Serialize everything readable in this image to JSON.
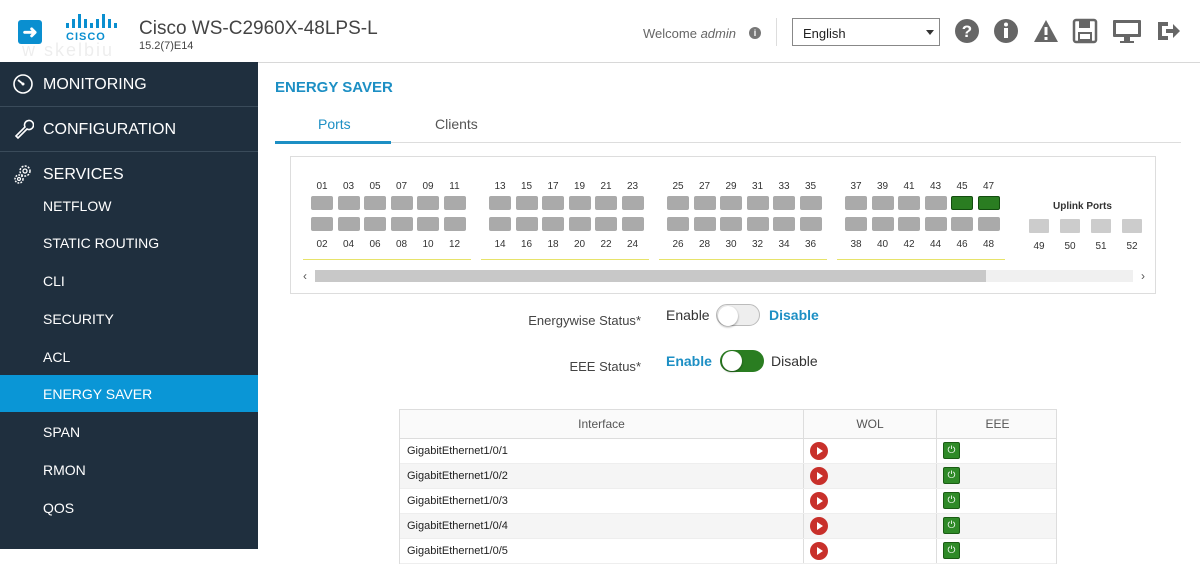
{
  "header": {
    "logo_text": "CISCO",
    "device_name": "Cisco WS-C2960X-48LPS-L",
    "version": "15.2(7)E14",
    "welcome_prefix": "Welcome ",
    "welcome_user": "admin",
    "language": "English"
  },
  "sidebar": {
    "monitoring": "MONITORING",
    "configuration": "CONFIGURATION",
    "services": "SERVICES",
    "items": [
      {
        "label": "NETFLOW"
      },
      {
        "label": "STATIC ROUTING"
      },
      {
        "label": "CLI"
      },
      {
        "label": "SECURITY"
      },
      {
        "label": "ACL"
      },
      {
        "label": "ENERGY SAVER",
        "active": true
      },
      {
        "label": "SPAN"
      },
      {
        "label": "RMON"
      },
      {
        "label": "QOS"
      }
    ]
  },
  "main": {
    "title": "ENERGY SAVER",
    "tabs": [
      {
        "label": "Ports",
        "active": true
      },
      {
        "label": "Clients"
      }
    ],
    "ports": {
      "groups": [
        {
          "top": [
            "01",
            "03",
            "05",
            "07",
            "09",
            "11"
          ],
          "bottom": [
            "02",
            "04",
            "06",
            "08",
            "10",
            "12"
          ],
          "top_on": [
            false,
            false,
            false,
            false,
            false,
            false
          ]
        },
        {
          "top": [
            "13",
            "15",
            "17",
            "19",
            "21",
            "23"
          ],
          "bottom": [
            "14",
            "16",
            "18",
            "20",
            "22",
            "24"
          ],
          "top_on": [
            false,
            false,
            false,
            false,
            false,
            false
          ]
        },
        {
          "top": [
            "25",
            "27",
            "29",
            "31",
            "33",
            "35"
          ],
          "bottom": [
            "26",
            "28",
            "30",
            "32",
            "34",
            "36"
          ],
          "top_on": [
            false,
            false,
            false,
            false,
            false,
            false
          ]
        },
        {
          "top": [
            "37",
            "39",
            "41",
            "43",
            "45",
            "47"
          ],
          "bottom": [
            "38",
            "40",
            "42",
            "44",
            "46",
            "48"
          ],
          "top_on": [
            false,
            false,
            false,
            false,
            true,
            true
          ]
        }
      ],
      "uplink_title": "Uplink Ports",
      "uplinks": [
        "49",
        "50",
        "51",
        "52"
      ]
    },
    "energywise": {
      "label": "Energywise Status",
      "required_mark": "*",
      "enable": "Enable",
      "disable": "Disable",
      "value": "Disable"
    },
    "eee": {
      "label": "EEE Status",
      "required_mark": "*",
      "enable": "Enable",
      "disable": "Disable",
      "value": "Enable"
    },
    "table": {
      "headers": [
        "Interface",
        "WOL",
        "EEE"
      ],
      "rows": [
        {
          "interface": "GigabitEthernet1/0/1"
        },
        {
          "interface": "GigabitEthernet1/0/2"
        },
        {
          "interface": "GigabitEthernet1/0/3"
        },
        {
          "interface": "GigabitEthernet1/0/4"
        },
        {
          "interface": "GigabitEthernet1/0/5"
        }
      ]
    }
  },
  "colors": {
    "accent": "#1d8fc4",
    "sidebar_bg": "#1f2f3e",
    "active_item": "#0a96d6",
    "port_on": "#2a7d21",
    "wol": "#c8302b",
    "eee": "#2f8a28"
  }
}
